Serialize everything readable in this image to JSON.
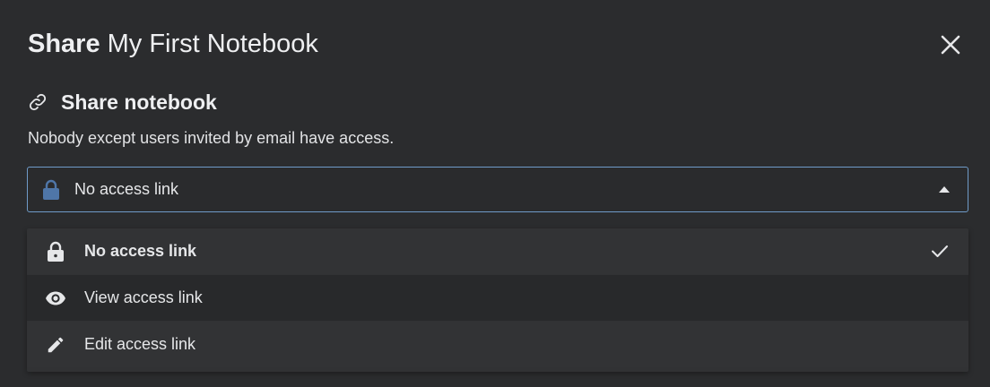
{
  "dialog": {
    "title_strong": "Share",
    "title_rest": "My First Notebook",
    "close_icon": "close-icon"
  },
  "share_section": {
    "icon": "link-icon",
    "heading": "Share notebook",
    "description": "Nobody except users invited by email have access."
  },
  "access_select": {
    "icon": "lock-icon",
    "value": "No access link",
    "expanded": true,
    "accent_color": "#6f9bc8",
    "lock_color": "#4f76a8"
  },
  "access_options": [
    {
      "icon": "lock-icon",
      "label": "No access link",
      "selected": true
    },
    {
      "icon": "eye-icon",
      "label": "View access link",
      "selected": false
    },
    {
      "icon": "pencil-icon",
      "label": "Edit access link",
      "selected": false
    }
  ]
}
